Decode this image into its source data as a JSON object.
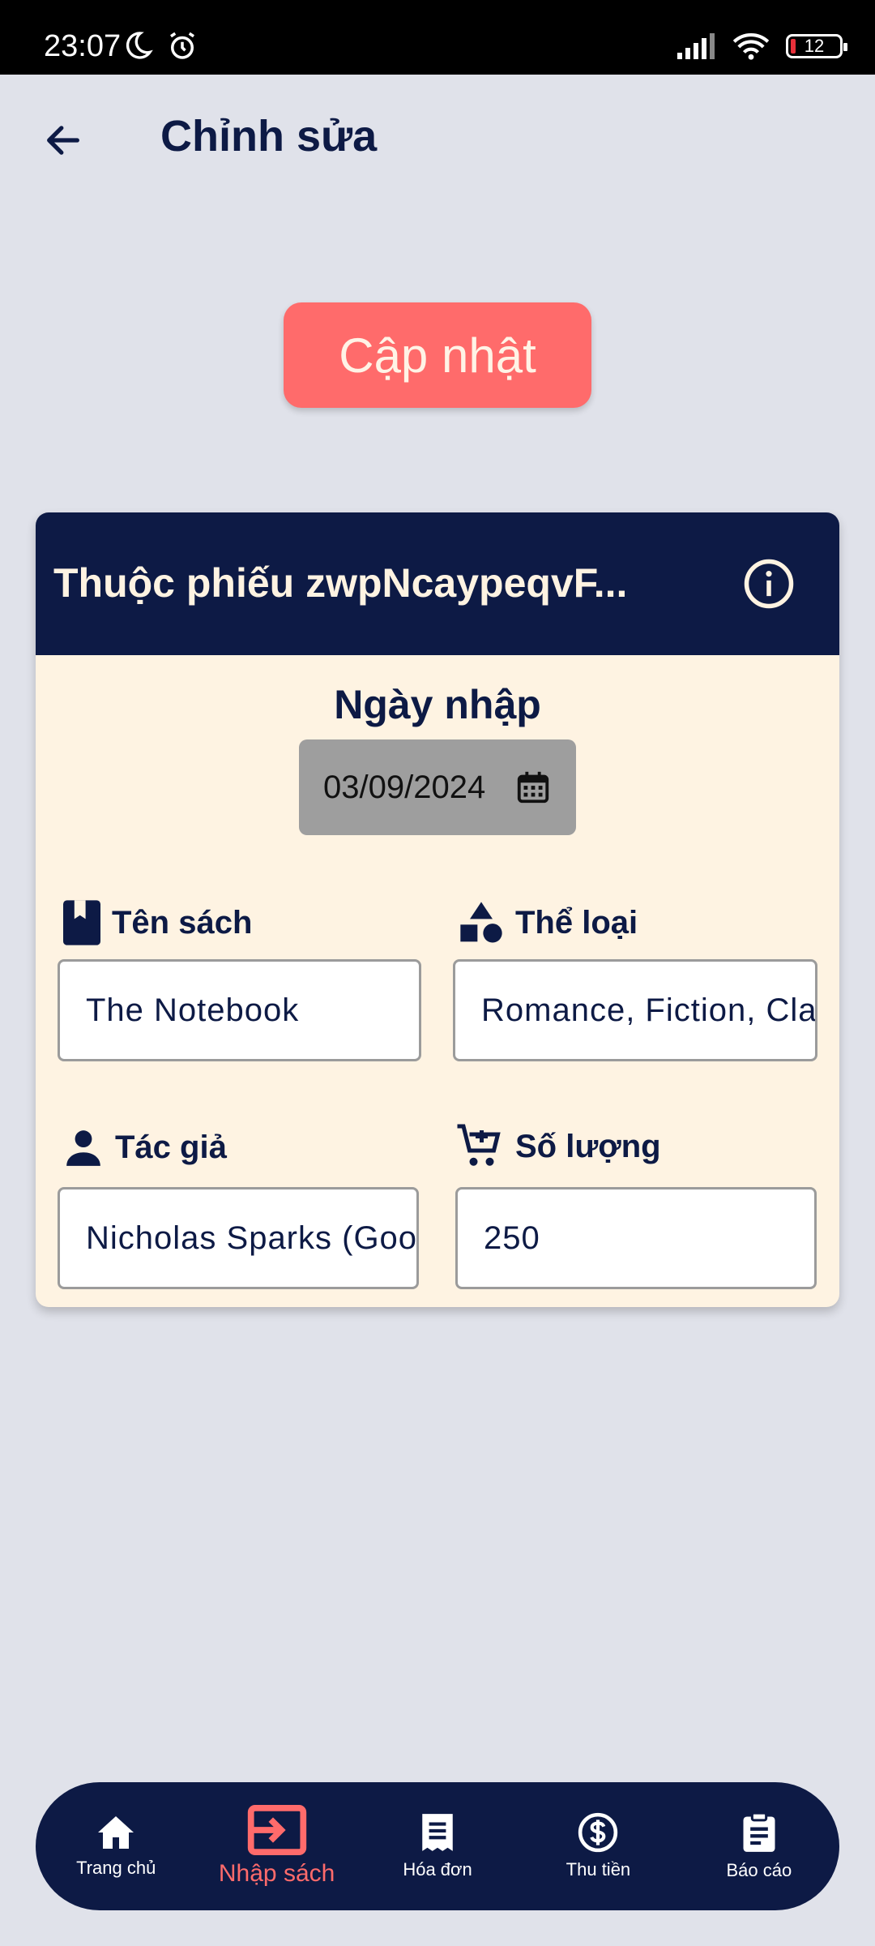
{
  "status_bar": {
    "time": "23:07",
    "battery": "12"
  },
  "header": {
    "title": "Chỉnh sửa"
  },
  "update_button": {
    "label": "Cập nhật"
  },
  "card": {
    "title": "Thuộc phiếu zwpNcaypeqvF...",
    "date_label": "Ngày nhập",
    "date_value": "03/09/2024",
    "fields": {
      "book_name": {
        "label": "Tên sách",
        "value": "The Notebook"
      },
      "genre": {
        "label": "Thể loại",
        "value": "Romance, Fiction, Classics"
      },
      "author": {
        "label": "Tác giả",
        "value": "Nicholas Sparks (Goodreads Author)"
      },
      "quantity": {
        "label": "Số lượng",
        "value": "250"
      }
    }
  },
  "nav": {
    "items": [
      {
        "label": "Trang chủ",
        "icon": "home-icon"
      },
      {
        "label": "Nhập sách",
        "icon": "input-icon",
        "active": true
      },
      {
        "label": "Hóa đơn",
        "icon": "receipt-icon"
      },
      {
        "label": "Thu tiền",
        "icon": "dollar-icon"
      },
      {
        "label": "Báo cáo",
        "icon": "report-icon"
      }
    ]
  },
  "colors": {
    "navy": "#0d1a45",
    "accent": "#ff6b6b",
    "card_bg": "#fef3e2",
    "page_bg": "#e0e2ea"
  }
}
